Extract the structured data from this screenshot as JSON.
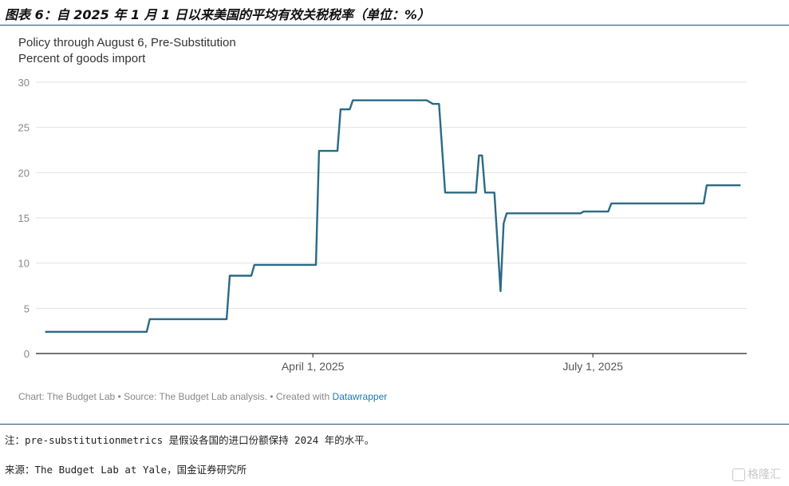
{
  "figure_title": "图表 6：自 2025 年 1 月 1 日以来美国的平均有效关税税率（单位：%）",
  "subtitle_line1": "Policy through August 6, Pre-Substitution",
  "subtitle_line2": "Percent of goods import",
  "credit_text": "Chart: The Budget Lab • Source: The Budget Lab analysis. • Created with ",
  "credit_link": "Datawrapper",
  "note": "注：pre-substitutionmetrics 是假设各国的进口份额保持 2024 年的水平。",
  "source": "来源：The Budget Lab at Yale，国金证券研究所",
  "watermark": "格隆汇",
  "colors": {
    "line": "#2b6a85",
    "grid": "#e2e2e2",
    "axis": "#222222"
  },
  "chart_data": {
    "type": "line",
    "title": "Policy through August 6, Pre-Substitution",
    "ylabel": "Percent of goods import",
    "ylim": [
      0,
      30
    ],
    "yticks": [
      0,
      5,
      10,
      15,
      20,
      25,
      30
    ],
    "xlim": [
      "2025-01-01",
      "2025-08-20"
    ],
    "xticks": [
      {
        "date": "2025-04-01",
        "label": "April 1, 2025"
      },
      {
        "date": "2025-07-01",
        "label": "July 1, 2025"
      }
    ],
    "series": [
      {
        "points": [
          [
            "2025-01-04",
            2.4
          ],
          [
            "2025-02-06",
            2.4
          ],
          [
            "2025-02-07",
            3.8
          ],
          [
            "2025-03-04",
            3.8
          ],
          [
            "2025-03-05",
            8.6
          ],
          [
            "2025-03-12",
            8.6
          ],
          [
            "2025-03-13",
            9.8
          ],
          [
            "2025-04-02",
            9.8
          ],
          [
            "2025-04-03",
            22.4
          ],
          [
            "2025-04-09",
            22.4
          ],
          [
            "2025-04-10",
            27.0
          ],
          [
            "2025-04-13",
            27.0
          ],
          [
            "2025-04-14",
            28.0
          ],
          [
            "2025-05-08",
            28.0
          ],
          [
            "2025-05-10",
            27.6
          ],
          [
            "2025-05-12",
            27.6
          ],
          [
            "2025-05-14",
            17.8
          ],
          [
            "2025-05-24",
            17.8
          ],
          [
            "2025-05-25",
            21.9
          ],
          [
            "2025-05-26",
            21.9
          ],
          [
            "2025-05-27",
            17.8
          ],
          [
            "2025-05-30",
            17.8
          ],
          [
            "2025-06-01",
            6.9
          ],
          [
            "2025-06-02",
            14.4
          ],
          [
            "2025-06-03",
            15.5
          ],
          [
            "2025-06-27",
            15.5
          ],
          [
            "2025-06-28",
            15.7
          ],
          [
            "2025-07-06",
            15.7
          ],
          [
            "2025-07-07",
            16.6
          ],
          [
            "2025-08-06",
            16.6
          ],
          [
            "2025-08-07",
            18.6
          ],
          [
            "2025-08-18",
            18.6
          ]
        ]
      }
    ]
  }
}
